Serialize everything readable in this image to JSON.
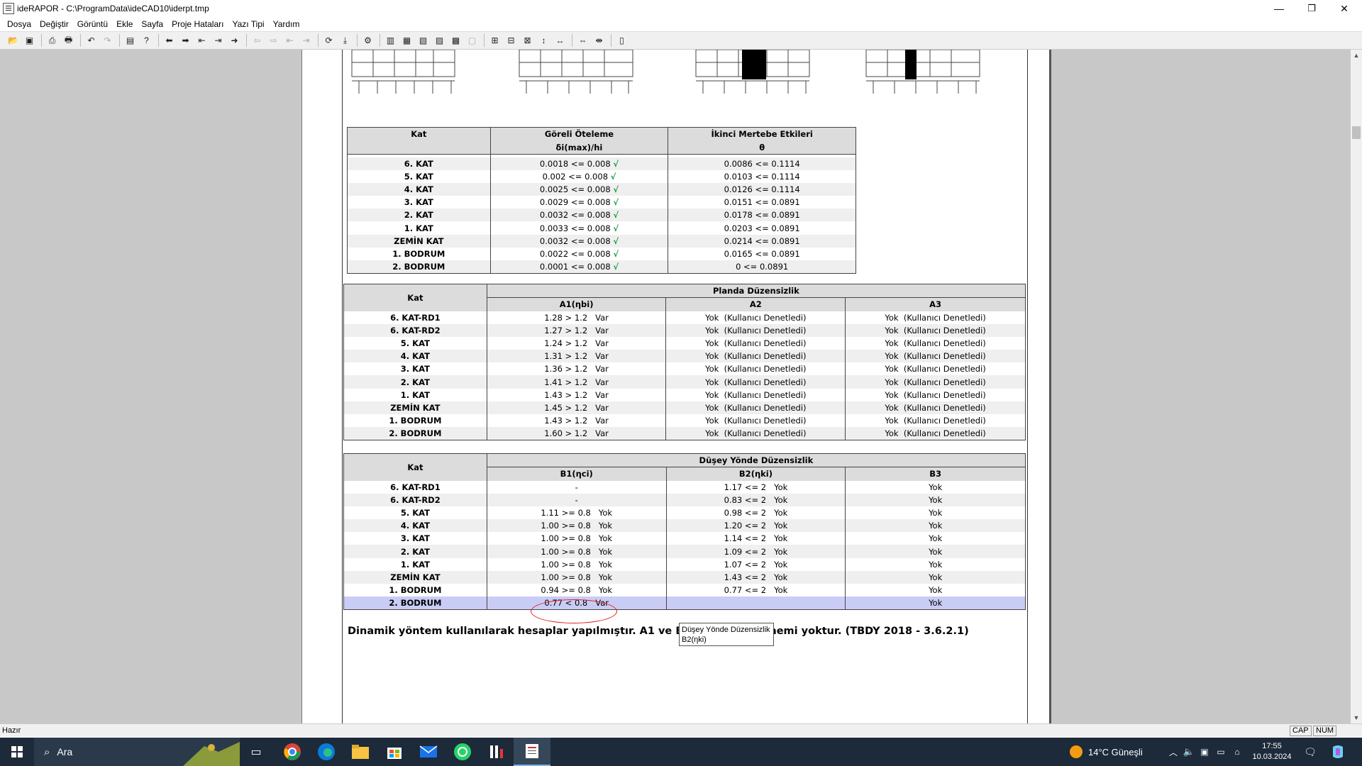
{
  "window": {
    "title": "ideRAPOR - C:\\ProgramData\\ideCAD10\\iderpt.tmp",
    "minimize": "—",
    "maximize": "❐",
    "close": "✕"
  },
  "menu": [
    "Dosya",
    "Değiştir",
    "Görüntü",
    "Ekle",
    "Sayfa",
    "Proje Hataları",
    "Yazı Tipi",
    "Yardım"
  ],
  "toolbar": {
    "icons": [
      "open-folder-icon",
      "save-icon",
      "print-preview-icon",
      "print-icon",
      "undo-icon",
      "redo-icon",
      "page-setup-icon",
      "help-icon",
      "arrow-left-icon",
      "arrow-right-icon",
      "arrow-first-icon",
      "arrow-last-icon",
      "jump-icon",
      "nav-disabled-1-icon",
      "nav-disabled-2-icon",
      "nav-disabled-3-icon",
      "nav-disabled-4-icon",
      "refresh-icon",
      "export-icon",
      "settings-icon",
      "layout-1-icon",
      "layout-2-icon",
      "layout-3-icon",
      "layout-4-icon",
      "layout-5-icon",
      "layout-6-icon",
      "zoom-1-icon",
      "zoom-2-icon",
      "zoom-3-icon",
      "zoom-4-icon",
      "zoom-5-icon",
      "fit-width-icon",
      "fit-page-icon",
      "columns-icon"
    ]
  },
  "table1": {
    "headers": [
      [
        "Kat",
        "Göreli Öteleme",
        "İkinci Mertebe Etkileri"
      ],
      [
        "",
        "δi(max)/hi",
        "θ"
      ]
    ],
    "rows": [
      [
        "6. KAT",
        "0.0018 <= 0.008",
        "0.0086 <= 0.1114"
      ],
      [
        "5. KAT",
        "0.002 <= 0.008",
        "0.0103 <= 0.1114"
      ],
      [
        "4. KAT",
        "0.0025 <= 0.008",
        "0.0126 <= 0.1114"
      ],
      [
        "3. KAT",
        "0.0029 <= 0.008",
        "0.0151 <= 0.0891"
      ],
      [
        "2. KAT",
        "0.0032 <= 0.008",
        "0.0178 <= 0.0891"
      ],
      [
        "1. KAT",
        "0.0033 <= 0.008",
        "0.0203 <= 0.0891"
      ],
      [
        "ZEMİN KAT",
        "0.0032 <= 0.008",
        "0.0214 <= 0.0891"
      ],
      [
        "1. BODRUM",
        "0.0022 <= 0.008",
        "0.0165 <= 0.0891"
      ],
      [
        "2. BODRUM",
        "0.0001 <= 0.008",
        "0 <= 0.0891"
      ]
    ],
    "check": "√"
  },
  "table2": {
    "header_kat": "Kat",
    "header_group": "Planda Düzensizlik",
    "sub": [
      "A1(ηbi)",
      "A2",
      "A3"
    ],
    "rows": [
      [
        "6. KAT-RD1",
        "1.28 > 1.2   Var",
        "Yok  (Kullanıcı Denetledi)",
        "Yok  (Kullanıcı Denetledi)"
      ],
      [
        "6. KAT-RD2",
        "1.27 > 1.2   Var",
        "Yok  (Kullanıcı Denetledi)",
        "Yok  (Kullanıcı Denetledi)"
      ],
      [
        "5. KAT",
        "1.24 > 1.2   Var",
        "Yok  (Kullanıcı Denetledi)",
        "Yok  (Kullanıcı Denetledi)"
      ],
      [
        "4. KAT",
        "1.31 > 1.2   Var",
        "Yok  (Kullanıcı Denetledi)",
        "Yok  (Kullanıcı Denetledi)"
      ],
      [
        "3. KAT",
        "1.36 > 1.2   Var",
        "Yok  (Kullanıcı Denetledi)",
        "Yok  (Kullanıcı Denetledi)"
      ],
      [
        "2. KAT",
        "1.41 > 1.2   Var",
        "Yok  (Kullanıcı Denetledi)",
        "Yok  (Kullanıcı Denetledi)"
      ],
      [
        "1. KAT",
        "1.43 > 1.2   Var",
        "Yok  (Kullanıcı Denetledi)",
        "Yok  (Kullanıcı Denetledi)"
      ],
      [
        "ZEMİN KAT",
        "1.45 > 1.2   Var",
        "Yok  (Kullanıcı Denetledi)",
        "Yok  (Kullanıcı Denetledi)"
      ],
      [
        "1. BODRUM",
        "1.43 > 1.2   Var",
        "Yok  (Kullanıcı Denetledi)",
        "Yok  (Kullanıcı Denetledi)"
      ],
      [
        "2. BODRUM",
        "1.60 > 1.2   Var",
        "Yok  (Kullanıcı Denetledi)",
        "Yok  (Kullanıcı Denetledi)"
      ]
    ]
  },
  "table3": {
    "header_kat": "Kat",
    "header_group": "Düşey Yönde Düzensizlik",
    "sub": [
      "B1(ηci)",
      "B2(ηki)",
      "B3"
    ],
    "rows": [
      [
        "6. KAT-RD1",
        "-",
        "1.17 <= 2   Yok",
        "Yok"
      ],
      [
        "6. KAT-RD2",
        "-",
        "0.83 <= 2   Yok",
        "Yok"
      ],
      [
        "5. KAT",
        "1.11 >= 0.8   Yok",
        "0.98 <= 2   Yok",
        "Yok"
      ],
      [
        "4. KAT",
        "1.00 >= 0.8   Yok",
        "1.20 <= 2   Yok",
        "Yok"
      ],
      [
        "3. KAT",
        "1.00 >= 0.8   Yok",
        "1.14 <= 2   Yok",
        "Yok"
      ],
      [
        "2. KAT",
        "1.00 >= 0.8   Yok",
        "1.09 <= 2   Yok",
        "Yok"
      ],
      [
        "1. KAT",
        "1.00 >= 0.8   Yok",
        "1.07 <= 2   Yok",
        "Yok"
      ],
      [
        "ZEMİN KAT",
        "1.00 >= 0.8   Yok",
        "1.43 <= 2   Yok",
        "Yok"
      ],
      [
        "1. BODRUM",
        "0.94 >= 0.8   Yok",
        "0.77 <= 2   Yok",
        "Yok"
      ],
      [
        "2. BODRUM",
        "0.77 < 0.8   Var",
        "",
        "Yok"
      ]
    ],
    "selected_row": 9
  },
  "summary": "Dinamik yöntem kullanılarak hesaplar yapılmıştır. A1 ve B2                    önemi yoktur. (TBDY 2018 - 3.6.2.1)",
  "tooltip": {
    "line1": "Düşey Yönde Düzensizlik",
    "line2": "B2(ηki)"
  },
  "status": {
    "text": "Hazır",
    "cap": "CAP",
    "num": "NUM"
  },
  "taskbar": {
    "search": "Ara",
    "weather": "14°C  Güneşli",
    "time": "17:55",
    "date": "10.03.2024"
  }
}
